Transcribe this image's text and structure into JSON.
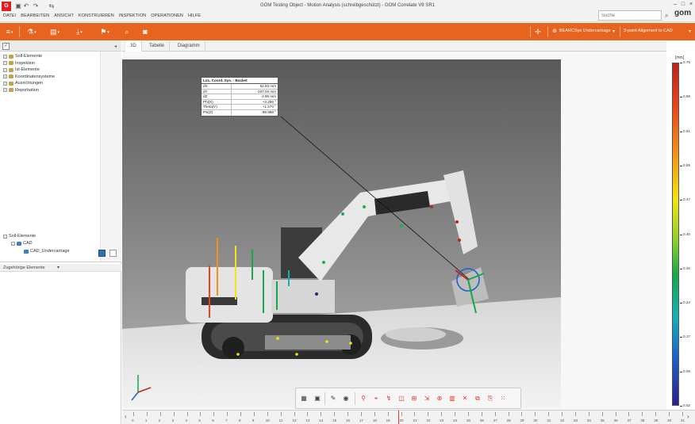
{
  "window": {
    "title": "GOM Testing Object - Motion Analysis (schreibgeschützt) - GOM Correlate V8 SR1",
    "brand": "gom",
    "menu": [
      "DATEI",
      "BEARBEITEN",
      "ANSICHT",
      "KONSTRUIEREN",
      "INSPEKTION",
      "OPERATIONEN",
      "HILFE"
    ],
    "search_placeholder": "Suche"
  },
  "toolbar": {
    "alignment_label": "BEARCSys Undercarriage",
    "alignment_mode_label": "3-point Alignment to CAD"
  },
  "left_panel": {
    "tree": [
      "Soll-Elemente",
      "Inspektion",
      "Ist-Elemente",
      "Koordinatensysteme",
      "Ausrichtungen",
      "Reporbation"
    ],
    "related_title": "Zugehörige Elemente",
    "related_items": [
      "Soll-Elemente",
      "CAD",
      "CAD_Undercarriage"
    ]
  },
  "view_tabs": [
    "3D",
    "Tabelle",
    "Diagramm"
  ],
  "label_table": {
    "title": "Loc. Coord. Sys. - Bucket",
    "rows": [
      {
        "key": "dX",
        "value": "52.83 mm"
      },
      {
        "key": "dY",
        "value": "-207.04 mm"
      },
      {
        "key": "dZ",
        "value": "-2.90 mm"
      },
      {
        "key": "Phi(X)",
        "value": "+3.256 °"
      },
      {
        "key": "Theta(Y)",
        "value": "+1.270 °"
      },
      {
        "key": "Psi(Z)",
        "value": "-89.998 °"
      }
    ]
  },
  "legend": {
    "unit": "[mm]",
    "ticks": [
      "0.75",
      "0.69",
      "0.61",
      "0.55",
      "0.47",
      "0.40",
      "0.32",
      "0.24",
      "0.17",
      "0.09",
      "0.02"
    ]
  },
  "timeline": {
    "frames": [
      "0",
      "1",
      "2",
      "3",
      "4",
      "5",
      "6",
      "7",
      "8",
      "9",
      "10",
      "11",
      "12",
      "13",
      "14",
      "15",
      "16",
      "17",
      "18",
      "19",
      "20",
      "21",
      "22",
      "23",
      "24",
      "25",
      "26",
      "27",
      "28",
      "29",
      "30",
      "31",
      "32",
      "33",
      "34",
      "35",
      "36",
      "37",
      "38",
      "39",
      "40",
      "41"
    ],
    "current": "20"
  },
  "icons": {
    "app": "gom-app-icon",
    "accent": "#e8641e"
  }
}
